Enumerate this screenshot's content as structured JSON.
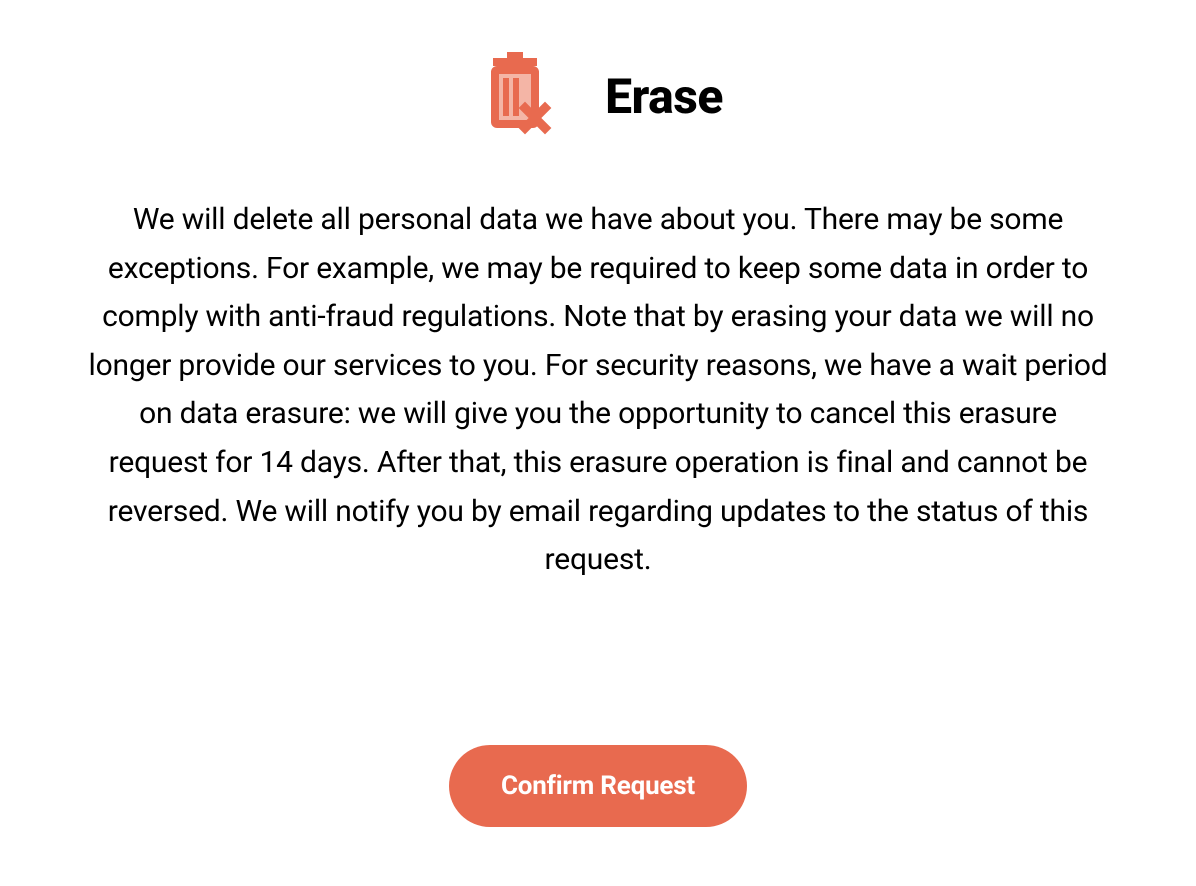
{
  "header": {
    "title": "Erase"
  },
  "description": "We will delete all personal data we have about you. There may be some exceptions. For example, we may be required to keep some data in order to comply with anti-fraud regulations. Note that by erasing your data we will no longer provide our services to you. For security reasons, we have a wait period on data erasure: we will give you the opportunity to cancel this erasure request for 14 days. After that, this erasure operation is final and cannot be reversed. We will notify you by email regarding updates to the status of this request.",
  "button": {
    "confirm_label": "Confirm Request"
  },
  "colors": {
    "accent": "#e86a4f",
    "icon_light": "#f4b5a6",
    "icon_dark": "#e86a4f"
  }
}
